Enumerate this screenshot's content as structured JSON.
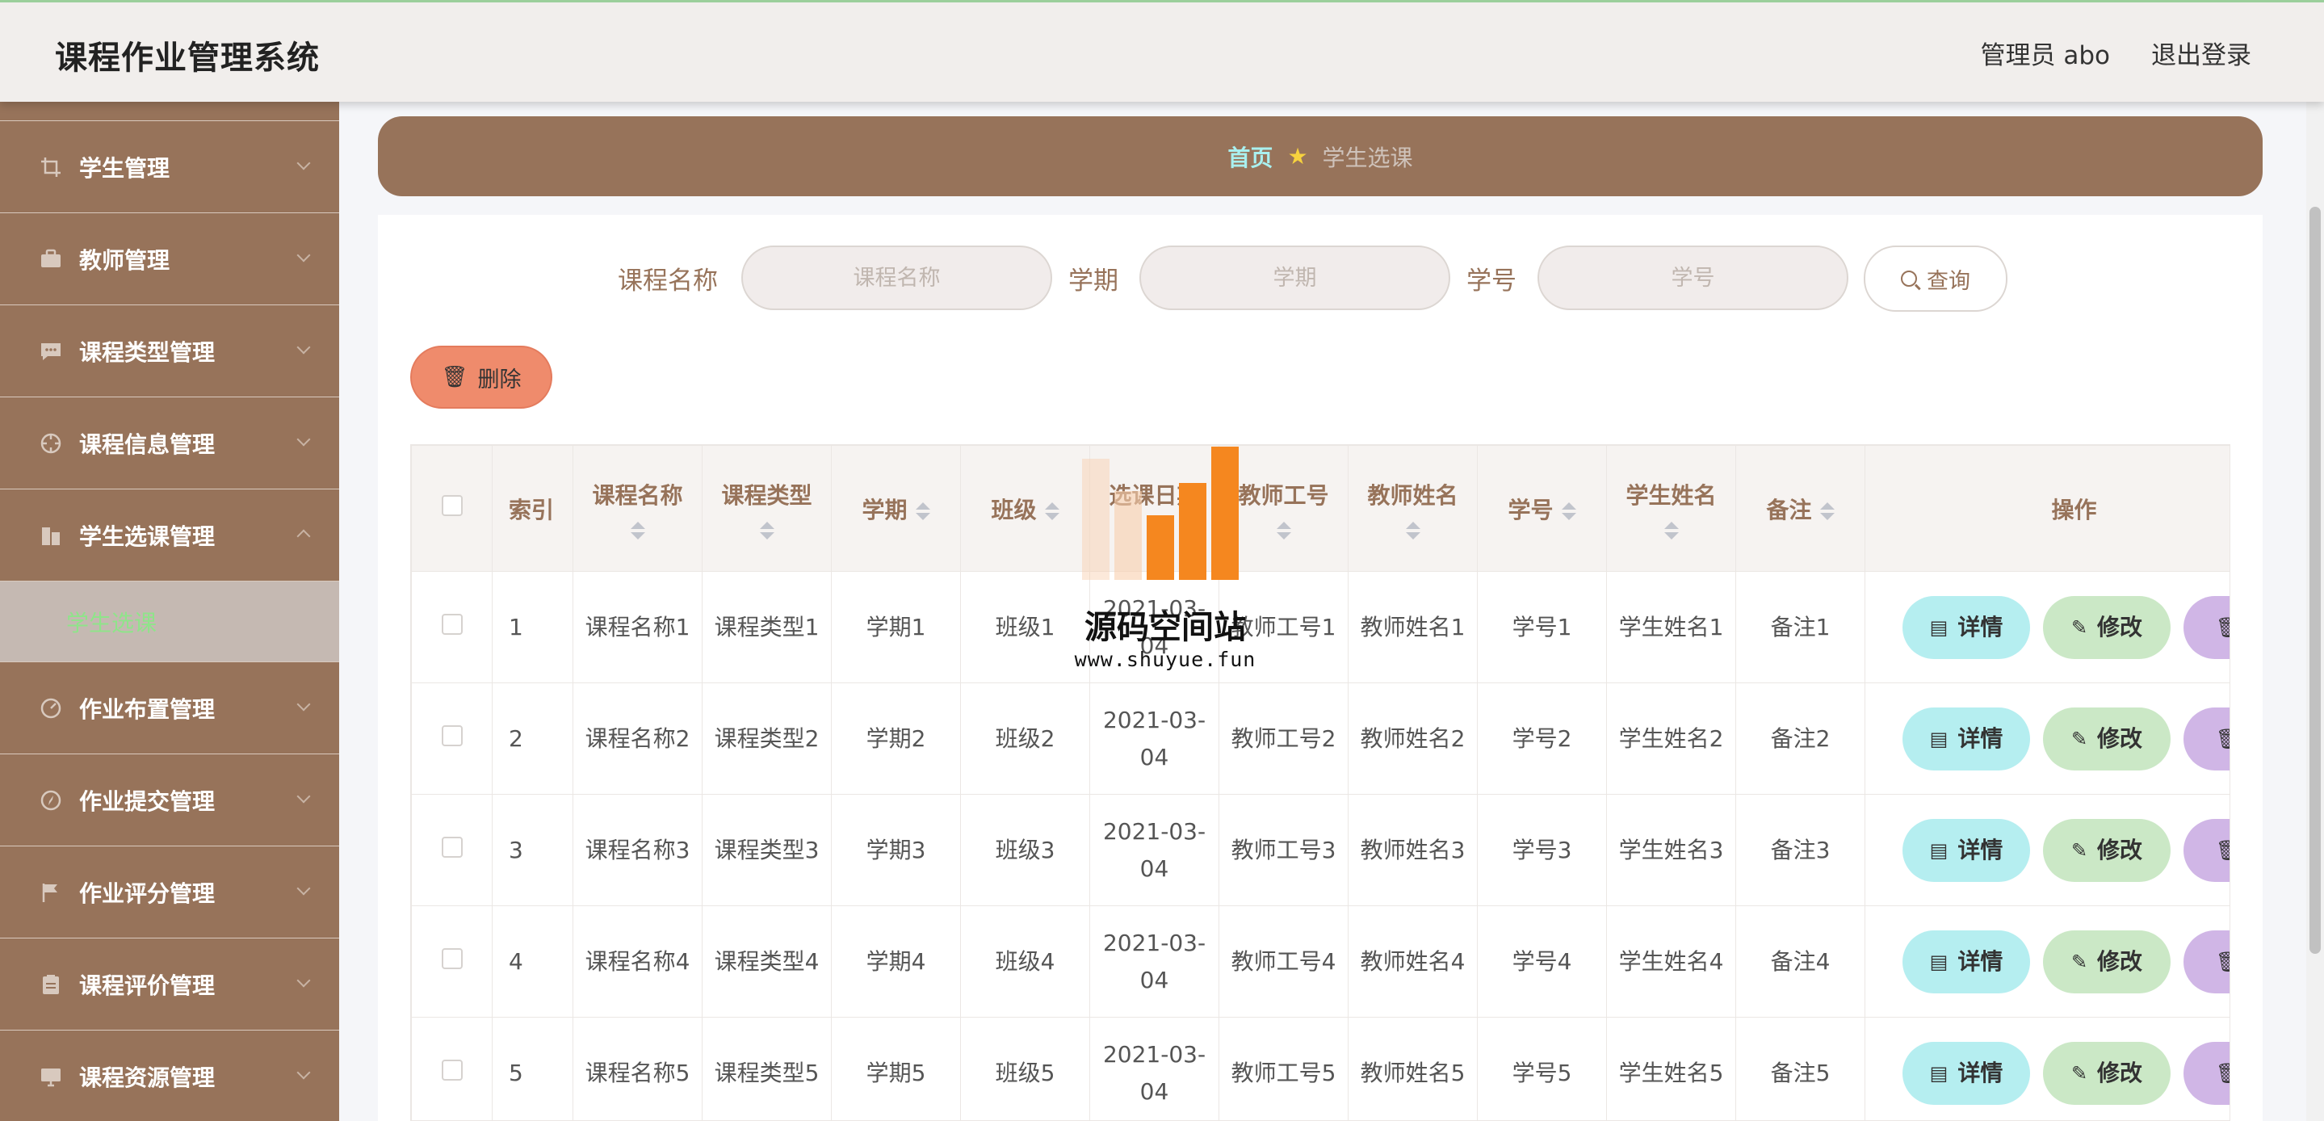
{
  "app": {
    "title": "课程作业管理系统"
  },
  "header": {
    "user": "管理员 abo",
    "logout": "退出登录"
  },
  "sidebar": {
    "items": [
      {
        "label": "学生管理",
        "icon": "crop-icon"
      },
      {
        "label": "教师管理",
        "icon": "briefcase-icon"
      },
      {
        "label": "课程类型管理",
        "icon": "chat-icon"
      },
      {
        "label": "课程信息管理",
        "icon": "crosshair-icon"
      },
      {
        "label": "学生选课管理",
        "icon": "building-icon",
        "expanded": true,
        "sub": [
          {
            "label": "学生选课",
            "active": true
          }
        ]
      },
      {
        "label": "作业布置管理",
        "icon": "gauge-icon"
      },
      {
        "label": "作业提交管理",
        "icon": "compass-icon"
      },
      {
        "label": "作业评分管理",
        "icon": "flag-icon"
      },
      {
        "label": "课程评价管理",
        "icon": "clipboard-icon"
      },
      {
        "label": "课程资源管理",
        "icon": "monitor-icon"
      }
    ]
  },
  "breadcrumb": {
    "home": "首页",
    "current": "学生选课"
  },
  "search": {
    "course_label": "课程名称",
    "course_placeholder": "课程名称",
    "term_label": "学期",
    "term_placeholder": "学期",
    "sid_label": "学号",
    "sid_placeholder": "学号",
    "query_button": "查询"
  },
  "actions": {
    "delete_button": "删除"
  },
  "table": {
    "headers": {
      "index": "索引",
      "course_name": "课程名称",
      "course_type": "课程类型",
      "term": "学期",
      "class": "班级",
      "select_date": "选课日期",
      "teacher_id": "教师工号",
      "teacher_name": "教师姓名",
      "student_id": "学号",
      "student_name": "学生姓名",
      "remark": "备注",
      "ops": "操作"
    },
    "rows": [
      {
        "index": "1",
        "course_name": "课程名称1",
        "course_type": "课程类型1",
        "term": "学期1",
        "class": "班级1",
        "select_date": "2021-03-04",
        "teacher_id": "教师工号1",
        "teacher_name": "教师姓名1",
        "student_id": "学号1",
        "student_name": "学生姓名1",
        "remark": "备注1"
      },
      {
        "index": "2",
        "course_name": "课程名称2",
        "course_type": "课程类型2",
        "term": "学期2",
        "class": "班级2",
        "select_date": "2021-03-04",
        "teacher_id": "教师工号2",
        "teacher_name": "教师姓名2",
        "student_id": "学号2",
        "student_name": "学生姓名2",
        "remark": "备注2"
      },
      {
        "index": "3",
        "course_name": "课程名称3",
        "course_type": "课程类型3",
        "term": "学期3",
        "class": "班级3",
        "select_date": "2021-03-04",
        "teacher_id": "教师工号3",
        "teacher_name": "教师姓名3",
        "student_id": "学号3",
        "student_name": "学生姓名3",
        "remark": "备注3"
      },
      {
        "index": "4",
        "course_name": "课程名称4",
        "course_type": "课程类型4",
        "term": "学期4",
        "class": "班级4",
        "select_date": "2021-03-04",
        "teacher_id": "教师工号4",
        "teacher_name": "教师姓名4",
        "student_id": "学号4",
        "student_name": "学生姓名4",
        "remark": "备注4"
      },
      {
        "index": "5",
        "course_name": "课程名称5",
        "course_type": "课程类型5",
        "term": "学期5",
        "class": "班级5",
        "select_date": "2021-03-04",
        "teacher_id": "教师工号5",
        "teacher_name": "教师姓名5",
        "student_id": "学号5",
        "student_name": "学生姓名5",
        "remark": "备注5"
      }
    ],
    "row_buttons": {
      "detail": "详情",
      "edit": "修改"
    }
  },
  "watermark": {
    "title": "源码空间站",
    "url": "www.shuyue.fun"
  },
  "colors": {
    "brand": "#97735a",
    "accent_green": "#8fe48a",
    "crumb_home": "#a9f0ef",
    "delete": "#ef8b6c",
    "detail": "#b5eef0",
    "edit": "#cbe8c6",
    "row_delete": "#d0b6e6"
  }
}
